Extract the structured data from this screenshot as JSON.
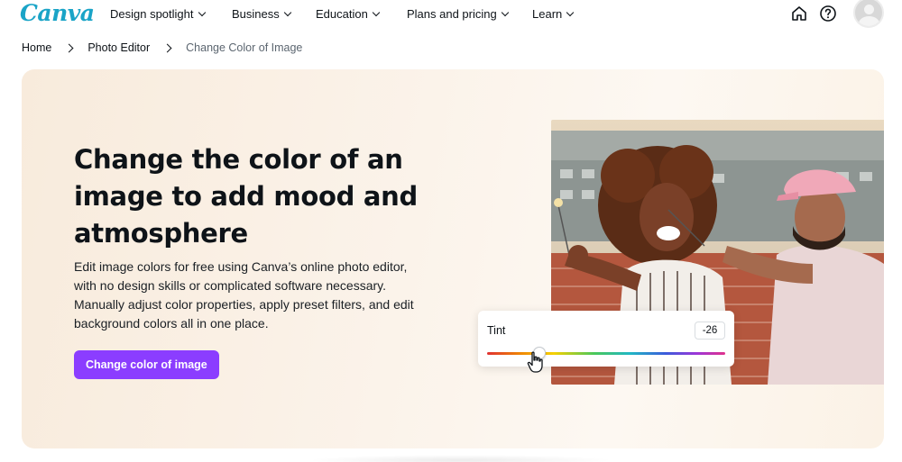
{
  "brand": {
    "logo_text": "Canva",
    "logo_color": "#1aa4c7",
    "accent": "#8b3dff"
  },
  "nav": {
    "items": [
      {
        "label": "Design spotlight"
      },
      {
        "label": "Business"
      },
      {
        "label": "Education"
      },
      {
        "label": "Plans and pricing"
      },
      {
        "label": "Learn"
      }
    ],
    "icons": [
      "home-icon",
      "help-icon",
      "avatar"
    ]
  },
  "breadcrumb": {
    "items": [
      {
        "label": "Home"
      },
      {
        "label": "Photo Editor"
      },
      {
        "label": "Change Color of Image"
      }
    ]
  },
  "hero": {
    "title": "Change the color of an image to add mood and atmosphere",
    "description": "Edit image colors for free using Canva’s online photo editor, with no design skills or complicated software necessary. Manually adjust color properties, apply preset filters, and edit background colors all in one place.",
    "cta_label": "Change color of image",
    "tint": {
      "label": "Tint",
      "value": "-26",
      "slider_fraction": 0.22
    }
  }
}
